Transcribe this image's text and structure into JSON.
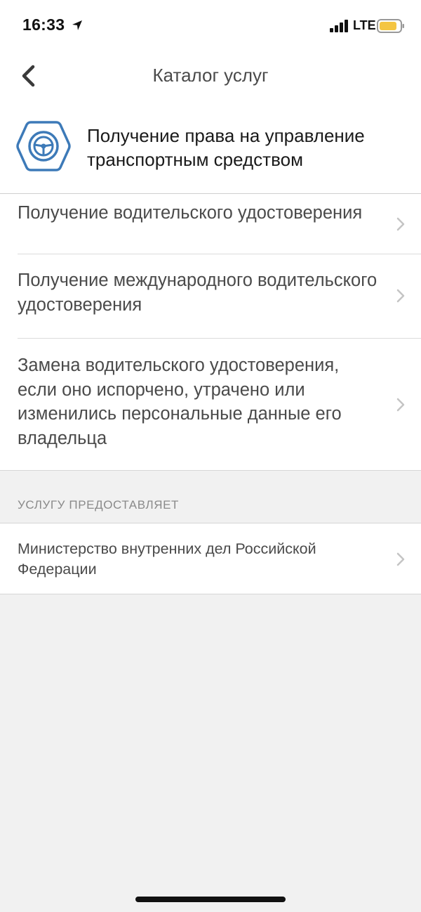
{
  "status_bar": {
    "time": "16:33",
    "network": "LTE",
    "icons": [
      "location-arrow-icon",
      "signal-bars-icon",
      "battery-icon"
    ],
    "battery_color": "#f4c542"
  },
  "nav": {
    "back_icon": "chevron-left-icon",
    "title": "Каталог услуг"
  },
  "category": {
    "icon": "steering-wheel-icon",
    "icon_color": "#3d7ab8",
    "title": "Получение права на управление транспортным средством"
  },
  "services": [
    {
      "label": "Получение водительского удостоверения"
    },
    {
      "label": "Получение международного водительского удостоверения"
    },
    {
      "label": "Замена водительского удостоверения, если оно испорчено, утрачено или изменились персональные данные его владельца"
    }
  ],
  "provider_section": {
    "caption": "УСЛУГУ ПРЕДОСТАВЛЯЕТ",
    "provider": "Министерство внутренних дел Российской Федерации"
  },
  "colors": {
    "background": "#f1f1f1",
    "surface": "#ffffff",
    "text": "#4a4a4a",
    "chevron": "#c4c4c4"
  }
}
